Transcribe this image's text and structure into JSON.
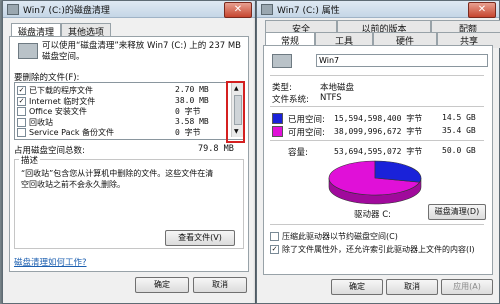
{
  "cleanup": {
    "title": "Win7 (C:)的磁盘清理",
    "tabs": [
      "磁盘清理",
      "其他选项"
    ],
    "intro": "可以使用“磁盘清理”来释放 Win7 (C:) 上的 237 MB 磁盘空间。",
    "files_label": "要删除的文件(F):",
    "files": [
      {
        "name": "已下载的程序文件",
        "size": "2.70 MB",
        "checked": true
      },
      {
        "name": "Internet 临时文件",
        "size": "38.0 MB",
        "checked": true
      },
      {
        "name": "Office 安装文件",
        "size": "0 字节",
        "checked": false
      },
      {
        "name": "回收站",
        "size": "3.58 MB",
        "checked": false
      },
      {
        "name": "Service Pack 备份文件",
        "size": "0 字节",
        "checked": false
      }
    ],
    "total_label": "占用磁盘空间总数:",
    "total_value": "79.8 MB",
    "desc_title": "描述",
    "desc_text_1": "“回收站”包含您从计算机中删除的文件。这些文件在清",
    "desc_text_2": "空回收站之前不会永久删除。",
    "view_files": "查看文件(V)",
    "help_link": "磁盘清理如何工作?",
    "ok": "确定",
    "cancel": "取消"
  },
  "props": {
    "title": "Win7 (C:) 属性",
    "tabs_row1": [
      "安全",
      "以前的版本",
      "配额"
    ],
    "tabs_row2": [
      "常规",
      "工具",
      "硬件",
      "共享"
    ],
    "name_value": "Win7",
    "type_label": "类型:",
    "type_value": "本地磁盘",
    "fs_label": "文件系统:",
    "fs_value": "NTFS",
    "used_label": "已用空间:",
    "used_bytes": "15,594,598,400 字节",
    "used_gb": "14.5 GB",
    "free_label": "可用空间:",
    "free_bytes": "38,099,996,672 字节",
    "free_gb": "35.4 GB",
    "cap_label": "容量:",
    "cap_bytes": "53,694,595,072 字节",
    "cap_gb": "50.0 GB",
    "drive_label": "驱动器 C:",
    "cleanup_btn": "磁盘清理(D)",
    "compress": "压缩此驱动器以节约磁盘空间(C)",
    "index": "除了文件属性外，还允许索引此驱动器上文件的内容(I)",
    "ok": "确定",
    "cancel": "取消",
    "apply": "应用(A)",
    "used_fraction": 0.29,
    "used_color": "#1a22d9",
    "free_color": "#e010d8"
  }
}
